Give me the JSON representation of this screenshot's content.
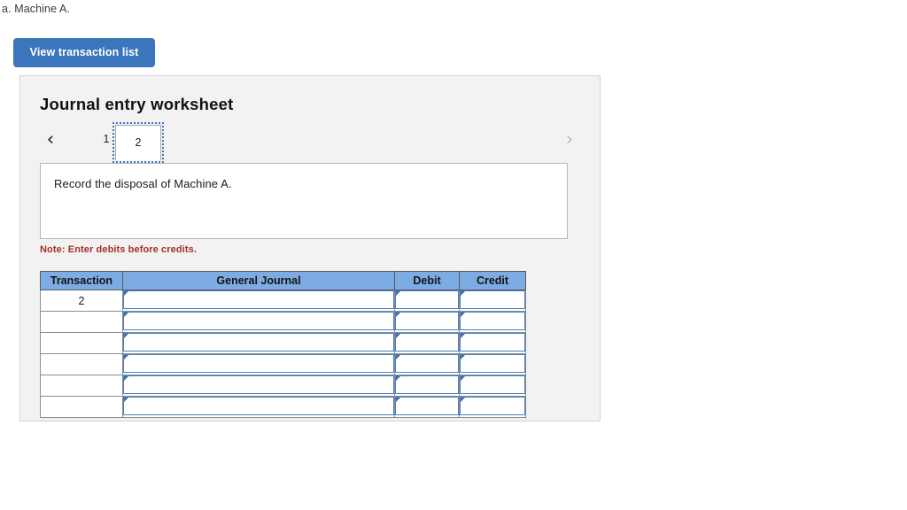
{
  "prompt": {
    "text": "a. Machine A."
  },
  "toolbar": {
    "view_transaction_list_label": "View transaction list"
  },
  "worksheet": {
    "title": "Journal entry worksheet",
    "tabs": [
      {
        "label": "1",
        "active": false
      },
      {
        "label": "2",
        "active": true
      }
    ],
    "nav": {
      "prev_icon": "chevron-left",
      "prev_glyph": "‹",
      "next_icon": "chevron-right",
      "next_glyph": "›"
    },
    "instruction": "Record the disposal of Machine A.",
    "note": "Note: Enter debits before credits."
  },
  "journal_table": {
    "columns": [
      "Transaction",
      "General Journal",
      "Debit",
      "Credit"
    ],
    "rows": [
      {
        "transaction": "2",
        "general_journal": "",
        "debit": "",
        "credit": ""
      },
      {
        "transaction": "",
        "general_journal": "",
        "debit": "",
        "credit": ""
      },
      {
        "transaction": "",
        "general_journal": "",
        "debit": "",
        "credit": ""
      },
      {
        "transaction": "",
        "general_journal": "",
        "debit": "",
        "credit": ""
      },
      {
        "transaction": "",
        "general_journal": "",
        "debit": "",
        "credit": ""
      },
      {
        "transaction": "",
        "general_journal": "",
        "debit": "",
        "credit": ""
      }
    ]
  },
  "colors": {
    "button_blue": "#3b76bd",
    "header_blue": "#7dace4",
    "card_bg": "#f2f2f2",
    "note_red": "#a33127",
    "field_border": "#4a7fbf"
  }
}
